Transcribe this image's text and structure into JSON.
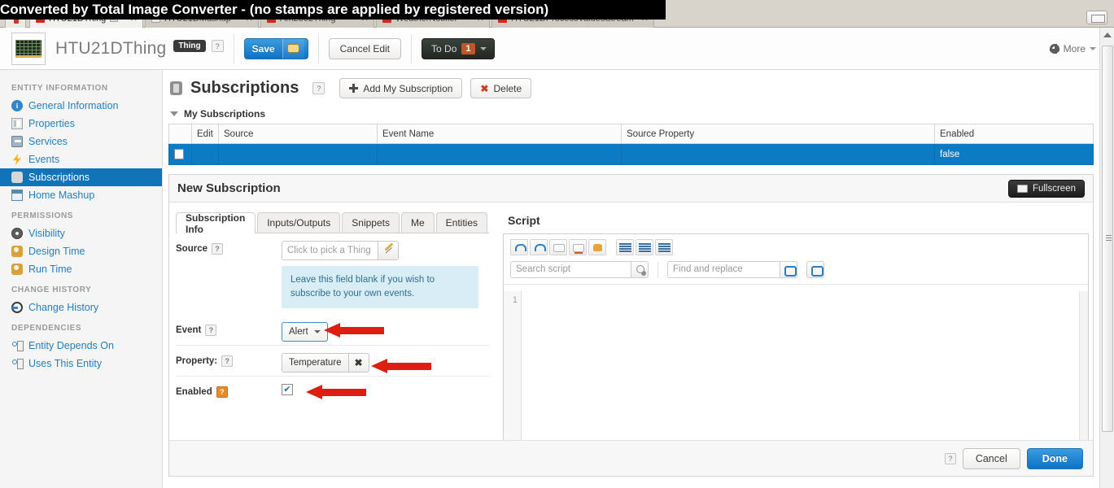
{
  "watermark": "Converted by Total Image Converter - (no stamps are applied by registered version)",
  "browser": {
    "tabs": [
      {
        "label": "HTU21DThing",
        "active": true,
        "favicon": "thing-favicon",
        "pinned": true
      },
      {
        "label": "HTU21DMashup",
        "active": false,
        "favicon": "doc-favicon",
        "pinned": false
      },
      {
        "label": "Am2302Thing",
        "active": false,
        "favicon": "thing-favicon",
        "pinned": false
      },
      {
        "label": "WeatherNotifier",
        "active": false,
        "favicon": "thing-favicon",
        "pinned": false
      },
      {
        "label": "HTU21DProcessValuesStream",
        "active": false,
        "favicon": "thing-favicon",
        "pinned": false
      }
    ],
    "close_glyph": "✕"
  },
  "header": {
    "entity_name": "HTU21DThing",
    "entity_type_badge": "Thing",
    "help_glyph": "?",
    "save_label": "Save",
    "cancel_edit_label": "Cancel Edit",
    "todo_label": "To Do",
    "todo_count": "1",
    "more_label": "More"
  },
  "sidebar": {
    "groups": [
      {
        "title": "ENTITY INFORMATION",
        "items": [
          {
            "label": "General Information",
            "icon": "info-icon",
            "active": false
          },
          {
            "label": "Properties",
            "icon": "properties-icon",
            "active": false
          },
          {
            "label": "Services",
            "icon": "services-icon",
            "active": false
          },
          {
            "label": "Events",
            "icon": "events-icon",
            "active": false
          },
          {
            "label": "Subscriptions",
            "icon": "subscriptions-icon",
            "active": true
          },
          {
            "label": "Home Mashup",
            "icon": "mashup-icon",
            "active": false
          }
        ]
      },
      {
        "title": "PERMISSIONS",
        "items": [
          {
            "label": "Visibility",
            "icon": "visibility-icon",
            "active": false
          },
          {
            "label": "Design Time",
            "icon": "user-icon",
            "active": false
          },
          {
            "label": "Run Time",
            "icon": "user-icon",
            "active": false
          }
        ]
      },
      {
        "title": "CHANGE HISTORY",
        "items": [
          {
            "label": "Change History",
            "icon": "history-icon",
            "active": false
          }
        ]
      },
      {
        "title": "DEPENDENCIES",
        "items": [
          {
            "label": "Entity Depends On",
            "icon": "dependency-icon",
            "active": false
          },
          {
            "label": "Uses This Entity",
            "icon": "dependency-icon",
            "active": false
          }
        ]
      }
    ]
  },
  "main": {
    "page_title": "Subscriptions",
    "help_glyph": "?",
    "add_subscription_label": "Add My Subscription",
    "delete_label": "Delete",
    "section_title": "My Subscriptions",
    "table": {
      "columns": [
        "",
        "Edit",
        "Source",
        "Event Name",
        "Source Property",
        "Enabled"
      ],
      "rows": [
        {
          "checkbox": true,
          "edit": "",
          "source": "",
          "event_name": "",
          "source_property": "",
          "enabled": "false"
        }
      ]
    }
  },
  "panel": {
    "title": "New Subscription",
    "fullscreen_label": "Fullscreen",
    "tabs": [
      {
        "label": "Subscription Info",
        "active": true
      },
      {
        "label": "Inputs/Outputs",
        "active": false
      },
      {
        "label": "Snippets",
        "active": false
      },
      {
        "label": "Me",
        "active": false
      },
      {
        "label": "Entities",
        "active": false
      }
    ],
    "form": {
      "source_label": "Source",
      "source_placeholder": "Click to pick a Thing",
      "source_hint": "Leave this field blank if you wish to subscribe to your own events.",
      "event_label": "Event",
      "event_value": "Alert",
      "property_label": "Property:",
      "property_value": "Temperature",
      "property_remove_glyph": "✖",
      "enabled_label": "Enabled",
      "enabled_checked": true,
      "help_glyph": "?"
    },
    "script": {
      "title": "Script",
      "search_placeholder": "Search script",
      "replace_placeholder": "Find and replace",
      "first_line_number": "1",
      "content": "",
      "toolbar_icons": [
        "undo-icon",
        "redo-icon",
        "comment-icon",
        "uncomment-icon",
        "hint-icon",
        "indent-icon",
        "outdent-icon",
        "format-icon"
      ]
    },
    "footer": {
      "help_glyph": "?",
      "cancel_label": "Cancel",
      "done_label": "Done"
    }
  },
  "colors": {
    "accent_blue": "#0d7ac4",
    "selected_row": "#0d7ac4",
    "sidebar_active": "#1274b8",
    "arrow_red": "#dd1f12",
    "todo_badge": "#c1552a",
    "hint_bg": "#d9edf7"
  }
}
